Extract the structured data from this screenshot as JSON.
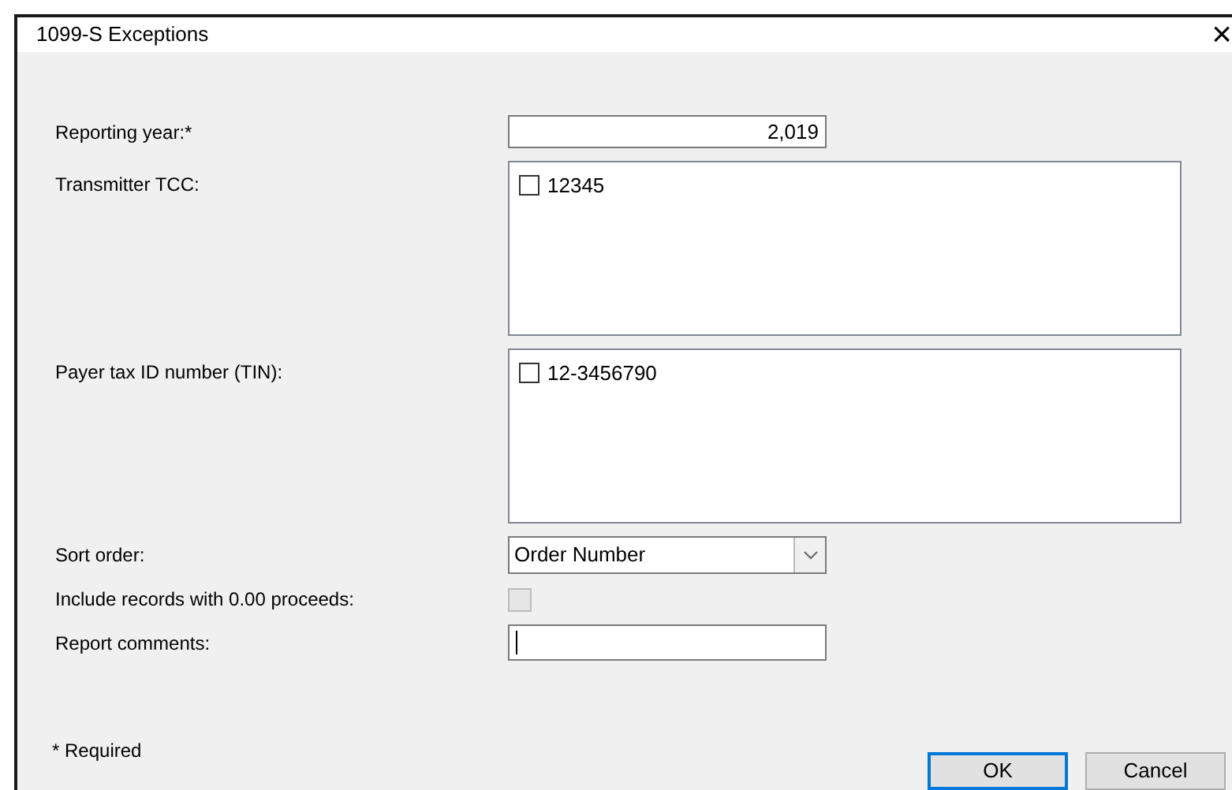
{
  "window": {
    "title": "1099-S Exceptions",
    "close": "×"
  },
  "fields": [
    {
      "kind": "number",
      "label": "Reporting year:*",
      "value": "2,019"
    },
    {
      "kind": "checklist",
      "label": "Transmitter TCC:",
      "items": [
        {
          "text": "12345",
          "checked": false
        }
      ]
    },
    {
      "kind": "checklist",
      "label": "Payer tax ID number (TIN):",
      "items": [
        {
          "text": "12-3456790",
          "checked": false
        }
      ]
    },
    {
      "kind": "dropdown",
      "label": "Sort order:",
      "value": "Order Number"
    },
    {
      "kind": "checkbox",
      "label": "Include records with 0.00 proceeds:",
      "checked": false,
      "disabled": true
    },
    {
      "kind": "text",
      "label": "Report comments:",
      "focused": true
    }
  ],
  "footnote": "* Required",
  "buttons": [
    {
      "label": "OK",
      "default": true
    },
    {
      "label": "Cancel",
      "default": false
    }
  ]
}
